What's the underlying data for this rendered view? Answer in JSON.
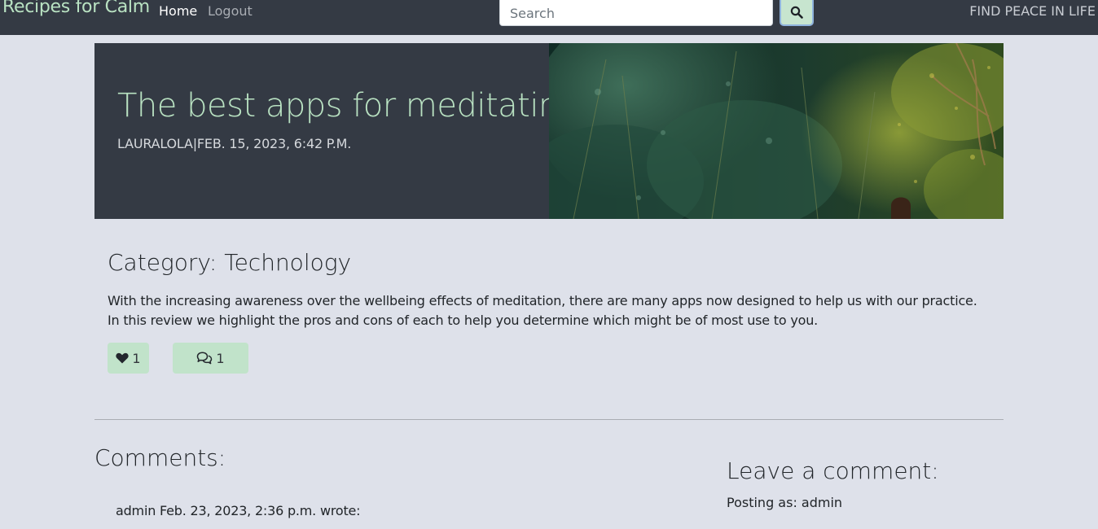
{
  "nav": {
    "brand": "Recipes for Calm",
    "links": [
      "Home",
      "Logout"
    ],
    "search_placeholder": "Search",
    "tagline": "FIND PEACE IN LIFE",
    "search_icon": "search-icon"
  },
  "post": {
    "title": "The best apps for meditating",
    "meta": "LAURALOLA|FEB. 15, 2023, 6:42 P.M.",
    "category": "Category: Technology",
    "excerpt": "With the increasing awareness over the wellbeing effects of meditation, there are many apps now designed to help us with our practice. In this review we highlight the pros and cons of each to help you determine which might be of most use to you.",
    "likes": "1",
    "comment_count": "1",
    "like_icon": "heart-icon",
    "comment_icon": "comments-icon"
  },
  "comments": {
    "heading": "Comments:",
    "items": [
      {
        "byline": "admin Feb. 23, 2023, 2:36 p.m. wrote:"
      }
    ]
  },
  "comment_form": {
    "heading": "Leave a comment:",
    "posting_as": "Posting as: admin"
  },
  "colors": {
    "navbar": "#343a44",
    "accent": "#b9e2c2",
    "button": "#c1e3ca",
    "page_bg": "#dee1ea"
  }
}
